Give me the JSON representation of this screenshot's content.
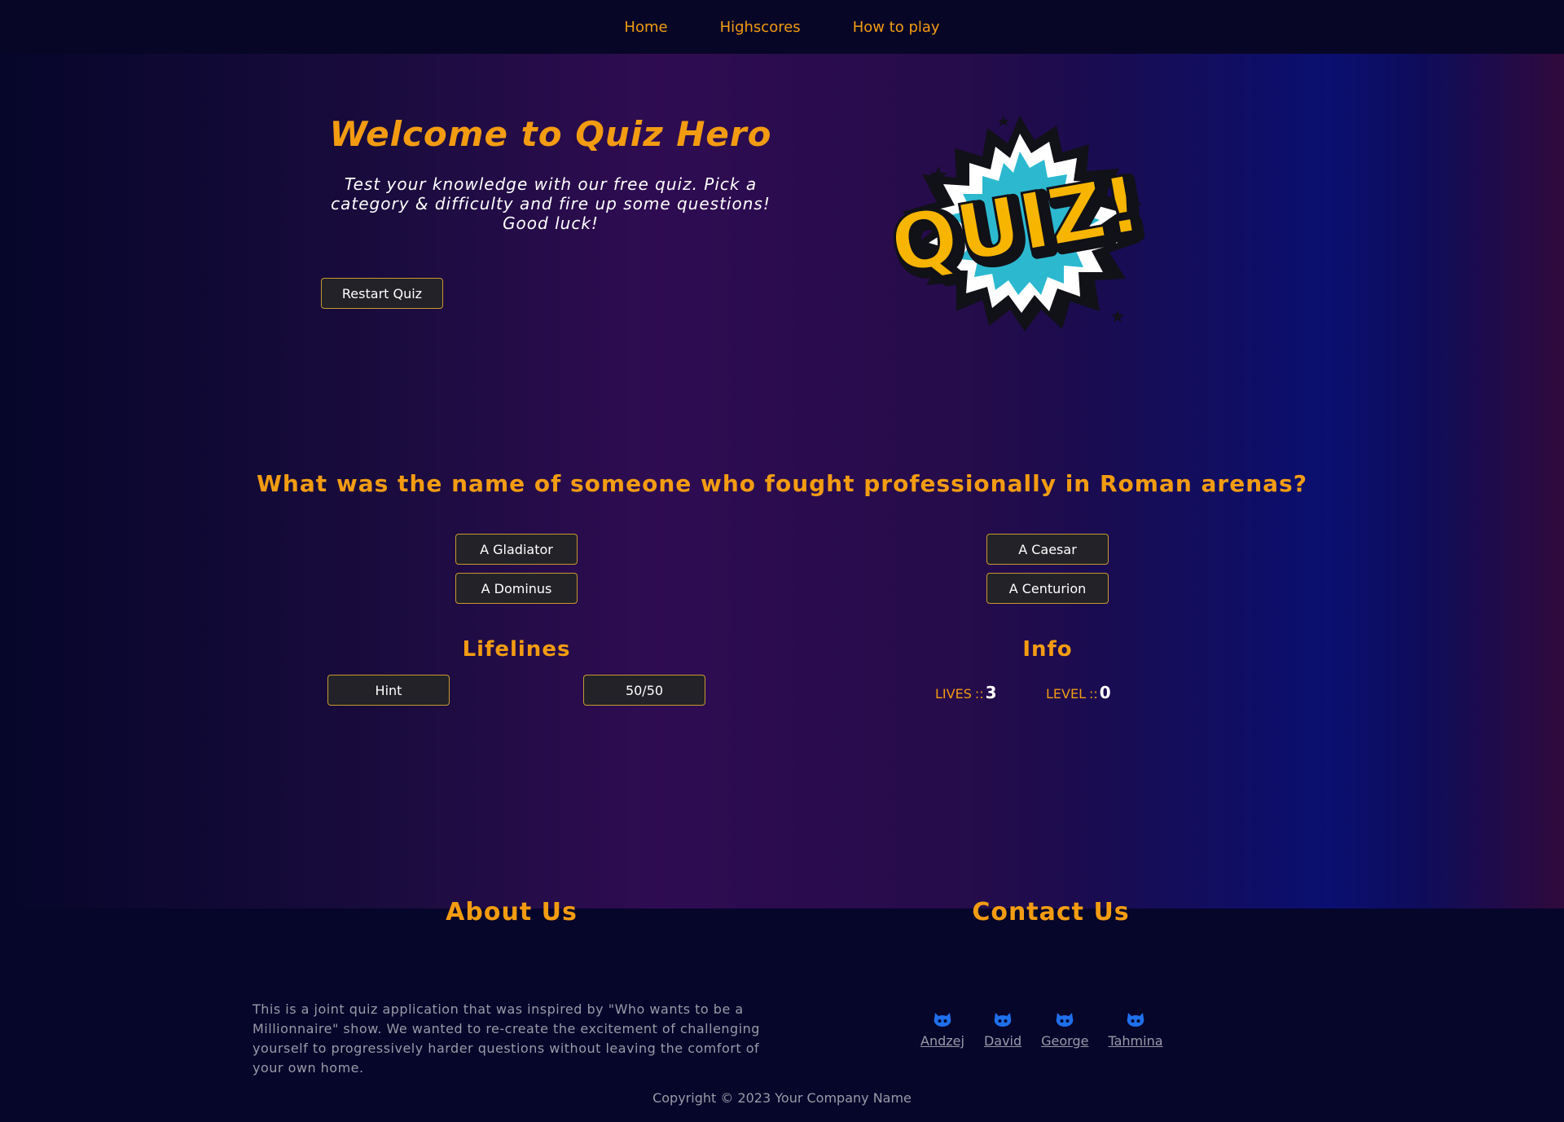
{
  "nav": {
    "items": [
      {
        "label": "Home"
      },
      {
        "label": "Highscores"
      },
      {
        "label": "How to play"
      }
    ]
  },
  "hero": {
    "title": "Welcome to Quiz Hero",
    "subtitle": "Test your knowledge with our free quiz. Pick a category & difficulty and fire up some questions! Good luck!",
    "restart_label": "Restart Quiz",
    "logo_text": "QUIZ!"
  },
  "quiz": {
    "question": "What was the name of someone who fought professionally in Roman arenas?",
    "answers": [
      {
        "label": "A Gladiator"
      },
      {
        "label": "A Caesar"
      },
      {
        "label": "A Dominus"
      },
      {
        "label": "A Centurion"
      }
    ]
  },
  "lifelines": {
    "heading": "Lifelines",
    "hint_label": "Hint",
    "fifty_label": "50/50"
  },
  "info": {
    "heading": "Info",
    "lives_label": "LIVES",
    "lives_value": "3",
    "level_label": "LEVEL",
    "level_value": "0",
    "separator": "::"
  },
  "footer": {
    "about_heading": "About Us",
    "about_text": "This is a joint quiz application that was inspired by \"Who wants to be a Millionnaire\" show. We wanted to re-create the excitement of challenging yourself to progressively harder questions without leaving the comfort of your own home.",
    "contact_heading": "Contact Us",
    "contacts": [
      {
        "name": "Andzej",
        "icon": "github-icon"
      },
      {
        "name": "David",
        "icon": "github-icon"
      },
      {
        "name": "George",
        "icon": "github-icon"
      },
      {
        "name": "Tahmina",
        "icon": "github-icon"
      }
    ],
    "copyright": "Copyright © 2023 Your Company Name"
  },
  "colors": {
    "accent": "#f39c12",
    "button_bg": "#222228",
    "button_border": "#c99a2e",
    "page_bg": "#06052a",
    "muted_text": "#9a9aa8",
    "github_blue": "#1f6feb"
  }
}
